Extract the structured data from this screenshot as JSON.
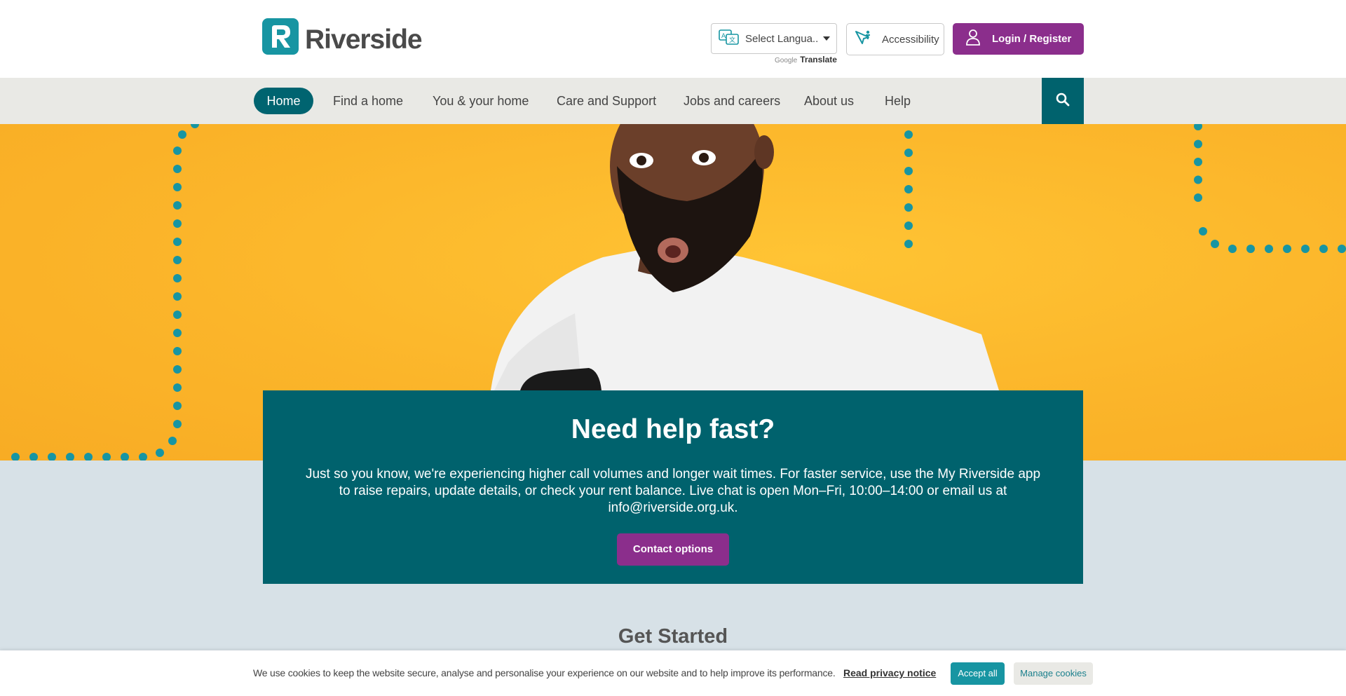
{
  "header": {
    "brand_name": "Riverside",
    "language_select": {
      "value": "Select Langua..."
    },
    "translate_credit": {
      "google": "Google",
      "label": "Translate"
    },
    "accessibility_label": "Accessibility",
    "login_label": "Login / Register"
  },
  "nav": {
    "items": [
      {
        "label": "Home",
        "active": true
      },
      {
        "label": "Find a home"
      },
      {
        "label": "You & your home"
      },
      {
        "label": "Care and Support"
      },
      {
        "label": "Jobs and careers"
      },
      {
        "label": "About us"
      },
      {
        "label": "Help"
      }
    ],
    "search_icon": "search-icon"
  },
  "help_card": {
    "title": "Need help fast?",
    "body": "Just so you know, we're experiencing higher call volumes and longer wait times. For faster service, use the My Riverside app to raise repairs, update details, or check your rent balance. Live chat is open Mon–Fri, 10:00–14:00 or email us at info@riverside.org.uk.",
    "button_label": "Contact options"
  },
  "section": {
    "title": "Get Started"
  },
  "cookie_bar": {
    "text": "We use cookies to keep the website secure, analyse and personalise your experience on our website and to help improve its performance.",
    "privacy_link": "Read privacy notice",
    "accept_label": "Accept all",
    "manage_label": "Manage cookies"
  },
  "colors": {
    "teal_dark": "#00626d",
    "teal_brand": "#1795a2",
    "purple": "#8b2e8c",
    "hero_yellow": "#fbb52a",
    "page_bg": "#d7e1e7"
  }
}
